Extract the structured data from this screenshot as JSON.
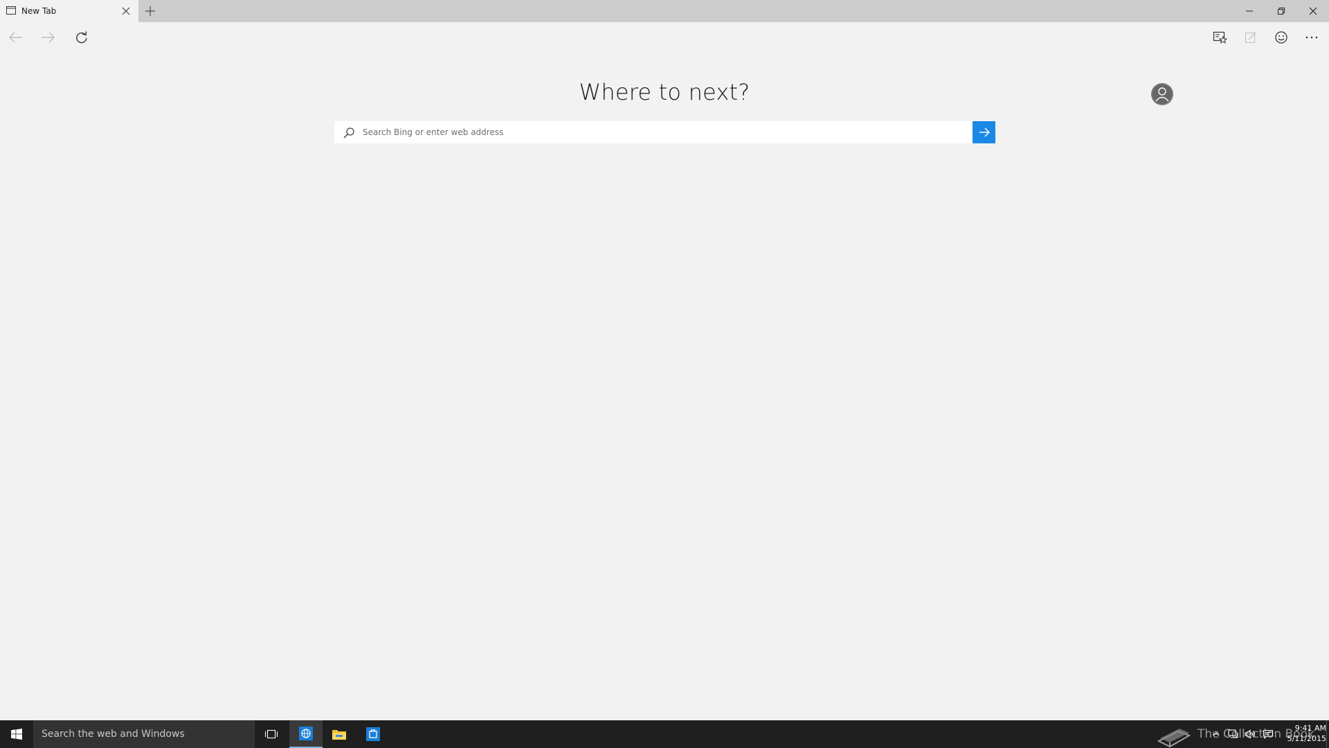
{
  "tab": {
    "title": "New Tab"
  },
  "content": {
    "headline": "Where to next?",
    "search_placeholder": "Search Bing or enter web address"
  },
  "taskbar": {
    "search_text": "Search the web and Windows",
    "watermark_text": "The Collection Book",
    "clock_time": "9:41 AM",
    "clock_date": "5/11/2015"
  },
  "colors": {
    "accent": "#1a88e6",
    "tabbar_bg": "#cccccc",
    "page_bg": "#f2f2f2",
    "taskbar_bg": "#1f1f1f"
  },
  "icons": {
    "tab": "page-icon",
    "back": "back-arrow-icon",
    "forward": "forward-arrow-icon",
    "refresh": "refresh-icon",
    "reading_view": "reading-list-icon",
    "web_note": "web-note-icon",
    "feedback": "smiley-icon",
    "more": "more-icon",
    "avatar": "user-avatar-icon",
    "search": "search-icon",
    "go": "arrow-right-icon"
  }
}
